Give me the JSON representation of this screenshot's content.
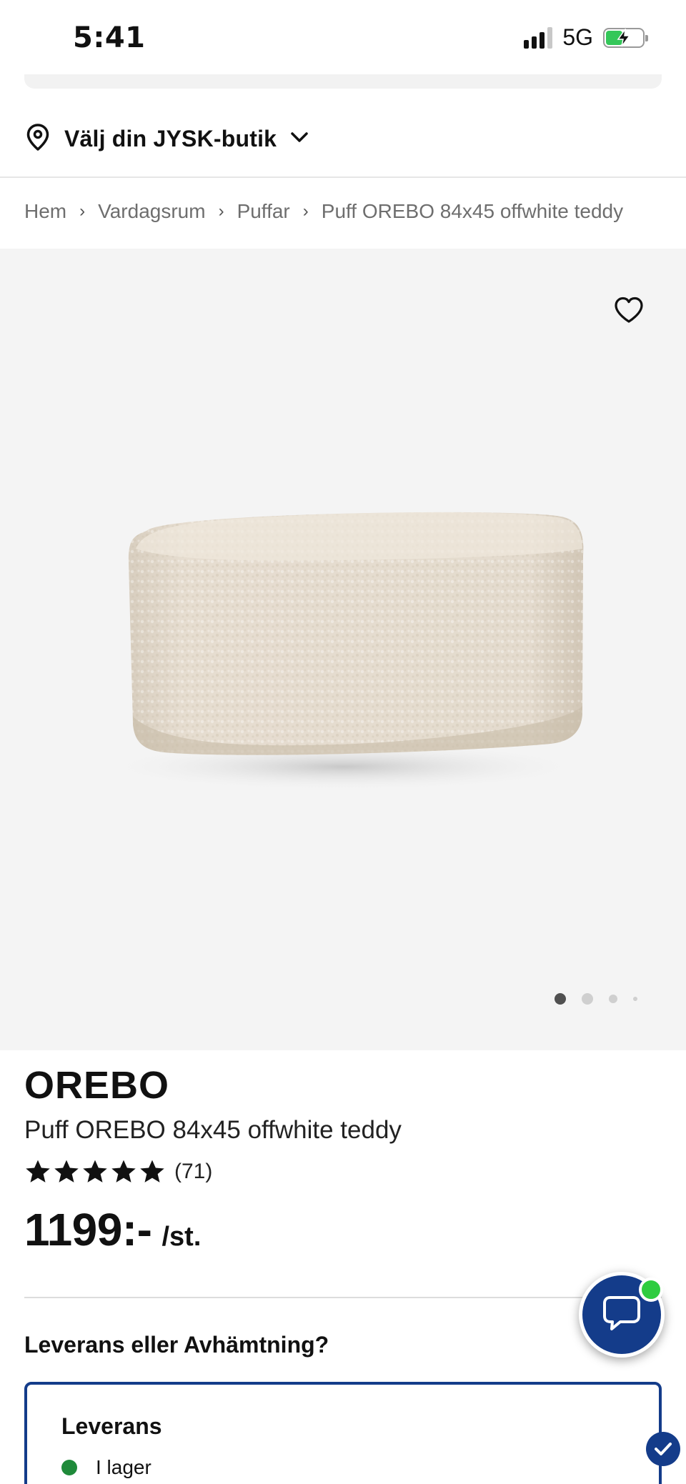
{
  "status_bar": {
    "time": "5:41",
    "network": "5G",
    "battery_level": 0.42
  },
  "store": {
    "label": "Välj din JYSK-butik",
    "icon": "location-pin-icon"
  },
  "breadcrumb": [
    "Hem",
    "Vardagsrum",
    "Puffar",
    "Puff OREBO 84x45 offwhite teddy"
  ],
  "gallery": {
    "image_alt": "Puff OREBO 84x45 offwhite teddy",
    "active_slide": 1,
    "slide_count": 4
  },
  "product": {
    "brand": "OREBO",
    "name": "Puff OREBO 84x45 offwhite teddy",
    "rating": 5,
    "rating_max": 5,
    "review_count": "(71)",
    "price": "1199:-",
    "unit": "/st."
  },
  "delivery": {
    "heading": "Leverans eller Avhämtning?",
    "option_title": "Leverans",
    "stock_status": "I lager",
    "stock_color": "#1f8a3a"
  },
  "colors": {
    "brand_blue": "#143c8a",
    "online_green": "#2ecc40"
  }
}
